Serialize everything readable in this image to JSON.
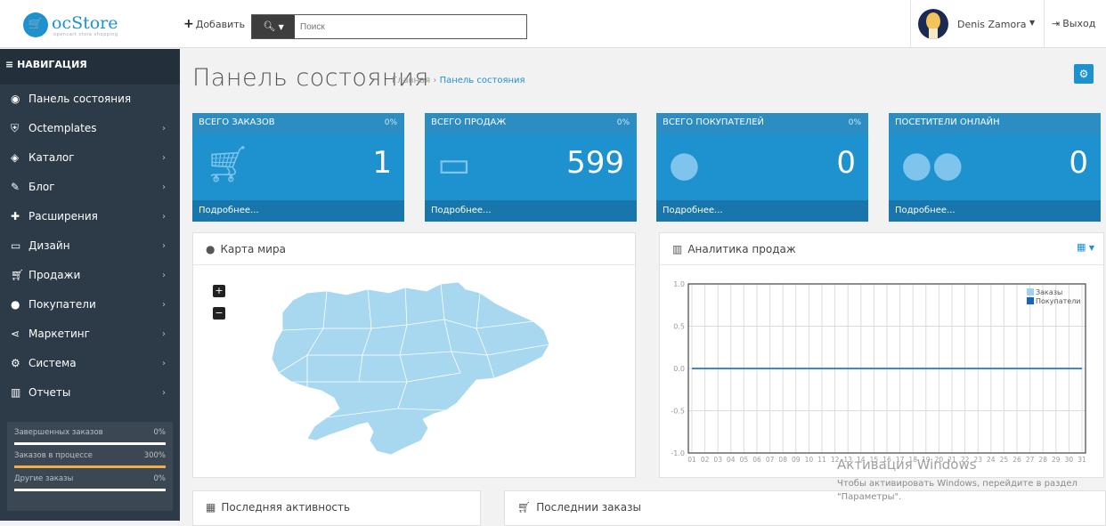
{
  "header": {
    "logo_text": "ocStore",
    "logo_tagline": "opencart store shopping",
    "add_label": "Добавить",
    "search_placeholder": "Поиск",
    "user_name": "Denis Zamora",
    "logout_label": "Выход"
  },
  "sidebar": {
    "title": "НАВИГАЦИЯ",
    "items": [
      {
        "label": "Панель состояния",
        "icon": "dashboard-icon",
        "has_children": false
      },
      {
        "label": "Octemplates",
        "icon": "shield-icon",
        "has_children": true
      },
      {
        "label": "Каталог",
        "icon": "tags-icon",
        "has_children": true
      },
      {
        "label": "Блог",
        "icon": "pencil-icon",
        "has_children": true
      },
      {
        "label": "Расширения",
        "icon": "puzzle-icon",
        "has_children": true
      },
      {
        "label": "Дизайн",
        "icon": "desktop-icon",
        "has_children": true
      },
      {
        "label": "Продажи",
        "icon": "cart-icon",
        "has_children": true
      },
      {
        "label": "Покупатели",
        "icon": "user-icon",
        "has_children": true
      },
      {
        "label": "Маркетинг",
        "icon": "share-icon",
        "has_children": true
      },
      {
        "label": "Система",
        "icon": "cog-icon",
        "has_children": true
      },
      {
        "label": "Отчеты",
        "icon": "bar-chart-icon",
        "has_children": true
      }
    ],
    "stats": [
      {
        "label": "Завершенных заказов",
        "value": "0%",
        "fill": 0,
        "color": "#ffffff"
      },
      {
        "label": "Заказов в процессе",
        "value": "300%",
        "fill": 1,
        "color": "#f0ad4e"
      },
      {
        "label": "Другие заказы",
        "value": "0%",
        "fill": 0,
        "color": "#ffffff"
      }
    ]
  },
  "page": {
    "title": "Панель состояния",
    "breadcrumb_home": "Главная",
    "breadcrumb_sep": "›",
    "breadcrumb_current": "Панель состояния"
  },
  "tiles": [
    {
      "title": "ВСЕГО ЗАКАЗОВ",
      "pct": "0%",
      "value": "1",
      "footer": "Подробнее...",
      "icon": "cart-icon"
    },
    {
      "title": "ВСЕГО ПРОДАЖ",
      "pct": "0%",
      "value": "599",
      "footer": "Подробнее...",
      "icon": "credit-card-icon"
    },
    {
      "title": "ВСЕГО ПОКУПАТЕЛЕЙ",
      "pct": "0%",
      "value": "0",
      "footer": "Подробнее...",
      "icon": "user-icon"
    },
    {
      "title": "ПОСЕТИТЕЛИ ОНЛАЙН",
      "pct": "",
      "value": "0",
      "footer": "Подробнее...",
      "icon": "users-icon"
    }
  ],
  "map_panel": {
    "title": "Карта мира",
    "zoom_in": "+",
    "zoom_out": "−",
    "map_color": "#a8d8f0"
  },
  "sales_panel": {
    "title": "Аналитика продаж"
  },
  "activity_panel": {
    "title": "Последняя активность"
  },
  "orders_panel": {
    "title": "Последнии заказы"
  },
  "windows_watermark": {
    "title": "Активация Windows",
    "line1": "Чтобы активировать Windows, перейдите в раздел",
    "line2": "\"Параметры\"."
  },
  "chart_data": {
    "type": "line",
    "x": [
      "01",
      "02",
      "03",
      "04",
      "05",
      "06",
      "07",
      "08",
      "09",
      "10",
      "11",
      "12",
      "13",
      "14",
      "15",
      "16",
      "17",
      "18",
      "19",
      "20",
      "21",
      "22",
      "23",
      "24",
      "25",
      "26",
      "27",
      "28",
      "29",
      "30",
      "31"
    ],
    "yticks": [
      "1.0",
      "0.5",
      "0.0",
      "-0.5",
      "-1.0"
    ],
    "ylim": [
      -1.0,
      1.0
    ],
    "grid": true,
    "legend_position": "top-right",
    "series": [
      {
        "name": "Заказы",
        "color": "#9fd0ef",
        "values": [
          0,
          0,
          0,
          0,
          0,
          0,
          0,
          0,
          0,
          0,
          0,
          0,
          0,
          0,
          0,
          0,
          0,
          0,
          0,
          0,
          0,
          0,
          0,
          0,
          0,
          0,
          0,
          0,
          0,
          0,
          0
        ]
      },
      {
        "name": "Покупатели",
        "color": "#1565c0",
        "values": [
          0,
          0,
          0,
          0,
          0,
          0,
          0,
          0,
          0,
          0,
          0,
          0,
          0,
          0,
          0,
          0,
          0,
          0,
          0,
          0,
          0,
          0,
          0,
          0,
          0,
          0,
          0,
          0,
          0,
          0,
          0
        ]
      }
    ]
  }
}
